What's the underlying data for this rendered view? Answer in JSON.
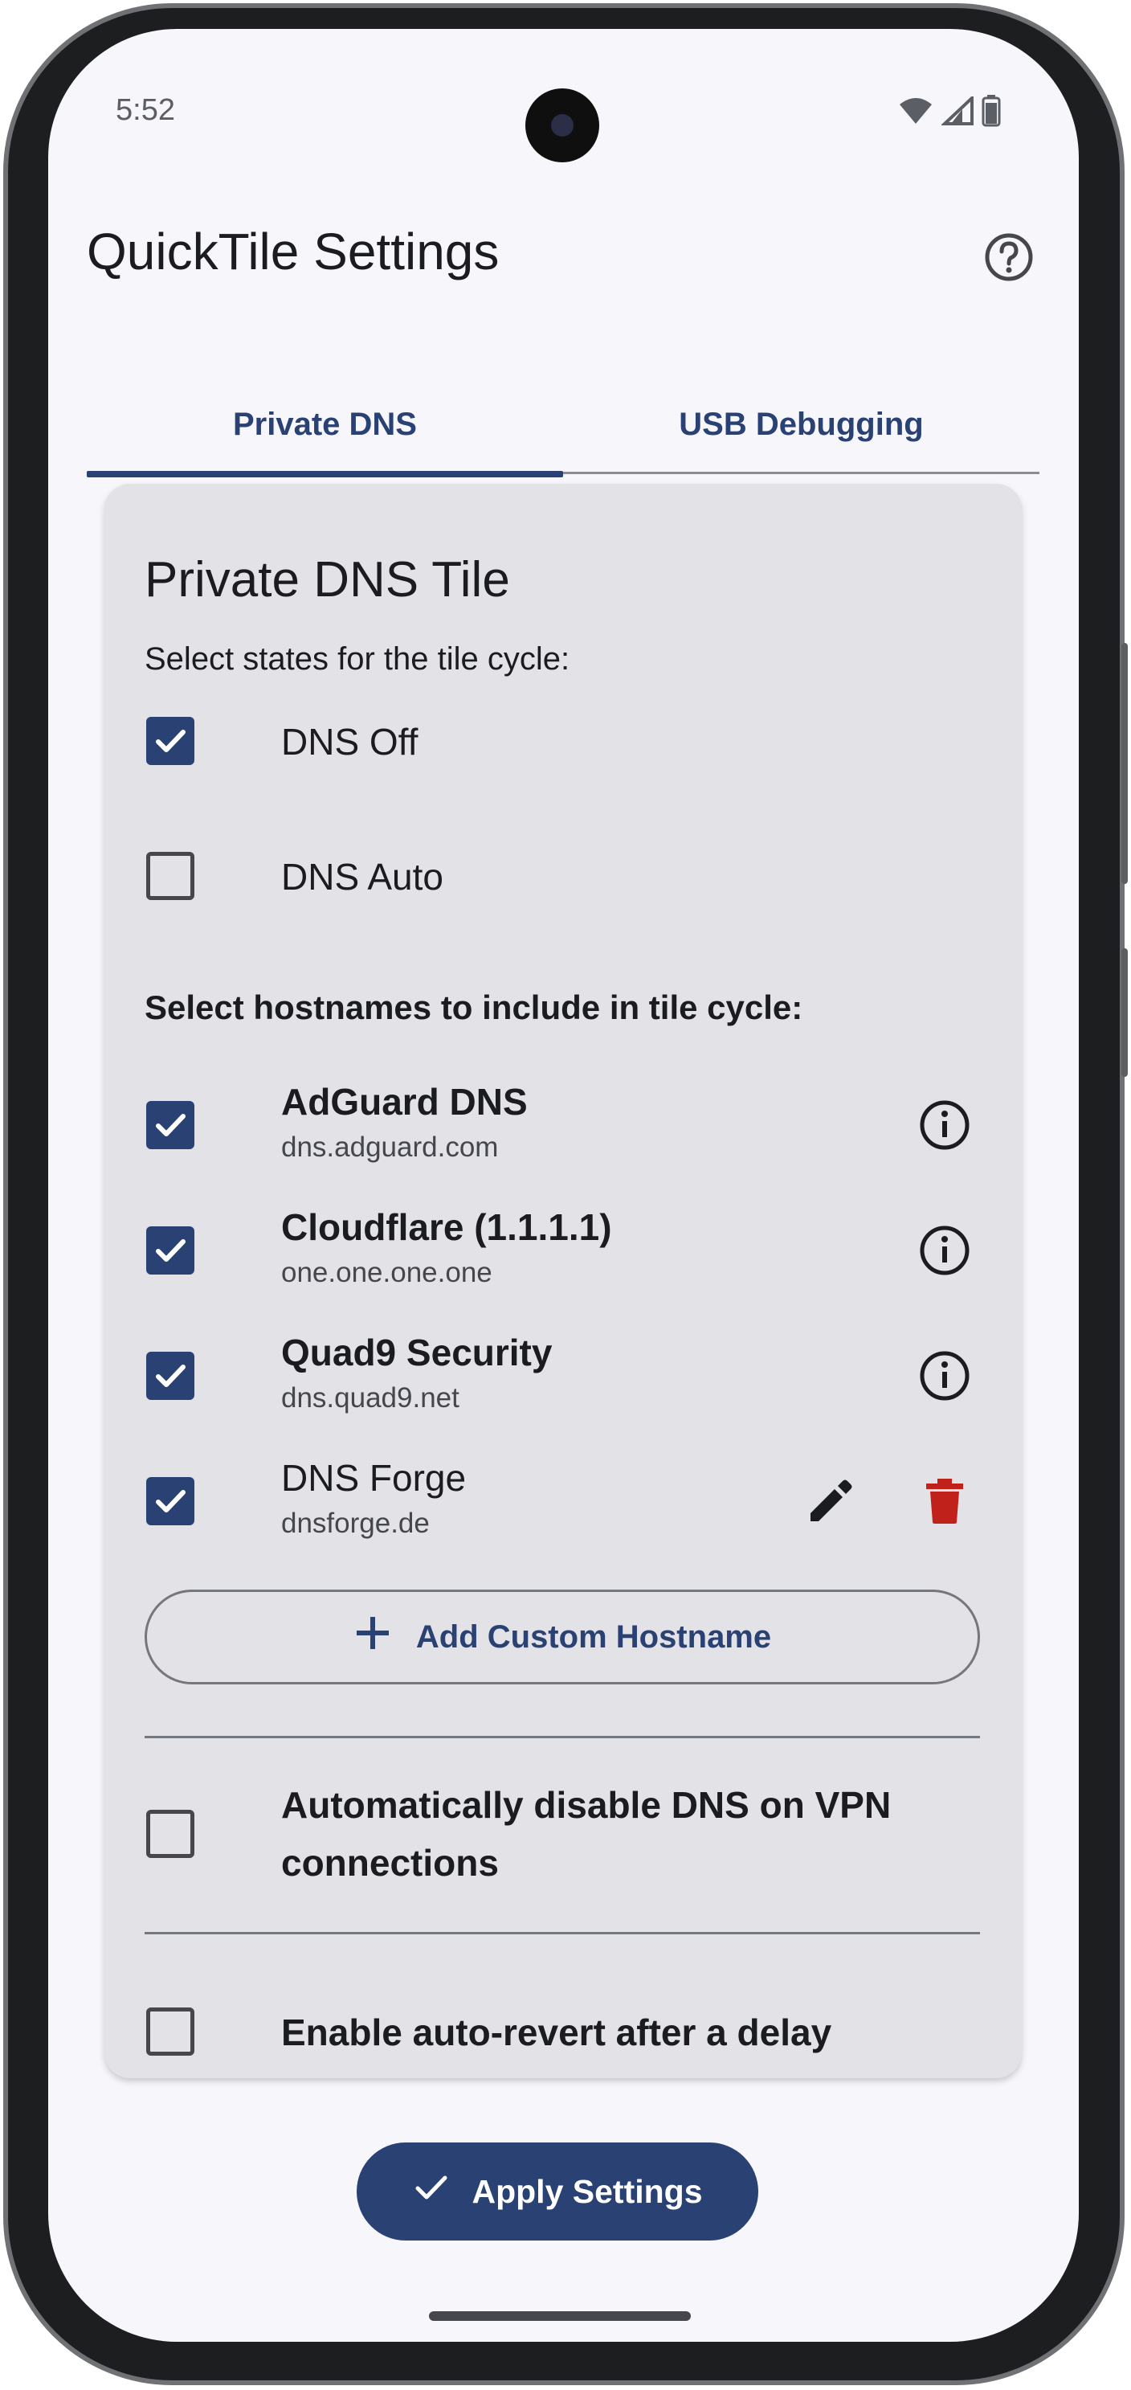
{
  "status_bar": {
    "time": "5:52",
    "icons": [
      "wifi-icon",
      "signal-icon",
      "battery-icon"
    ]
  },
  "header": {
    "title": "QuickTile Settings",
    "help_icon": "help-circle-icon"
  },
  "tabs": [
    {
      "label": "Private DNS",
      "active": true
    },
    {
      "label": "USB Debugging",
      "active": false
    }
  ],
  "card": {
    "title": "Private DNS Tile",
    "states_label": "Select states for the tile cycle:",
    "states": [
      {
        "label": "DNS Off",
        "checked": true
      },
      {
        "label": "DNS Auto",
        "checked": false
      }
    ],
    "hostnames_label": "Select hostnames to include in tile cycle:",
    "hostnames": [
      {
        "name": "AdGuard DNS",
        "host": "dns.adguard.com",
        "checked": true,
        "action": "info-icon"
      },
      {
        "name": "Cloudflare (1.1.1.1)",
        "host": "one.one.one.one",
        "checked": true,
        "action": "info-icon"
      },
      {
        "name": "Quad9 Security",
        "host": "dns.quad9.net",
        "checked": true,
        "action": "info-icon"
      },
      {
        "name": "DNS Forge",
        "host": "dnsforge.de",
        "checked": true,
        "actions": [
          "edit-icon",
          "delete-icon"
        ]
      }
    ],
    "add_button": "Add Custom Hostname",
    "vpn_option": {
      "label": "Automatically disable DNS on VPN connections",
      "checked": false
    },
    "revert_option": {
      "label": "Enable auto-revert after a delay",
      "checked": false
    }
  },
  "apply_button": "Apply Settings",
  "colors": {
    "accent": "#2a4173",
    "background": "#f6f6fb",
    "card": "#e2e2e7",
    "delete": "#c0211b"
  }
}
